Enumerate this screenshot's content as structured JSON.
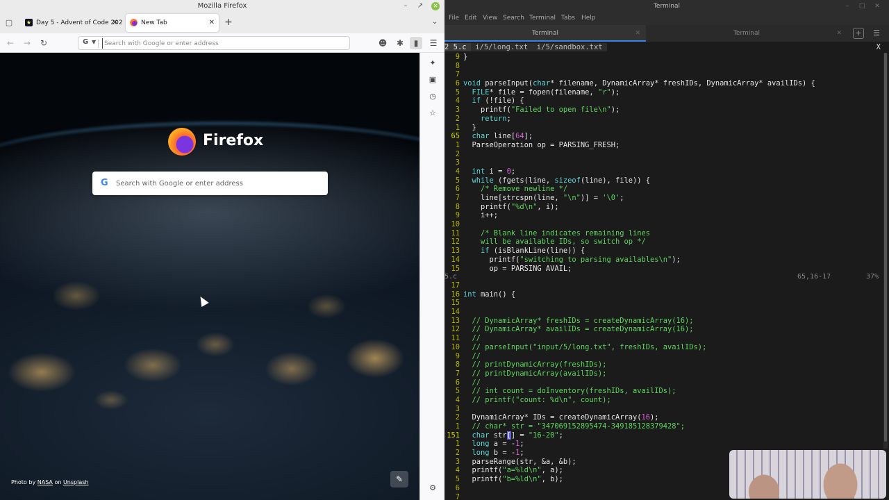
{
  "firefox": {
    "window_title": "Mozilla Firefox",
    "tabs": [
      {
        "label": "Day 5 - Advent of Code 2025",
        "active": false
      },
      {
        "label": "New Tab",
        "active": true
      }
    ],
    "url_placeholder": "Search with Google or enter address",
    "search_placeholder": "Search with Google or enter address",
    "logo_text": "Firefox",
    "credit": {
      "prefix": "Photo by",
      "author": "NASA",
      "on": "on",
      "site": "Unsplash"
    },
    "sidebar_icons": [
      "ai-chatbot-icon",
      "synced-tabs-icon",
      "history-icon",
      "bookmarks-icon",
      "settings-icon"
    ]
  },
  "terminal": {
    "window_title": "Terminal",
    "menu": [
      "File",
      "Edit",
      "View",
      "Search",
      "Terminal",
      "Tabs",
      "Help"
    ],
    "tabs": [
      {
        "label": "Terminal",
        "active": true
      },
      {
        "label": "Terminal",
        "active": false
      }
    ],
    "vim_tabs": [
      {
        "num": "2",
        "label": "5.c",
        "selected": true
      },
      {
        "label": "i/5/long.txt",
        "selected": false
      },
      {
        "label": "i/5/sandbox.txt",
        "selected": false
      }
    ],
    "vim_close": "X",
    "top_pane": [
      {
        "ln": "9",
        "code": "}"
      },
      {
        "ln": "8",
        "code": ""
      },
      {
        "ln": "7",
        "code": ""
      },
      {
        "ln": "6",
        "code": "void parseInput(char* filename, DynamicArray* freshIDs, DynamicArray* availIDs) {"
      },
      {
        "ln": "5",
        "code": "  FILE* file = fopen(filename, \"r\");"
      },
      {
        "ln": "4",
        "code": "  if (!file) {"
      },
      {
        "ln": "3",
        "code": "    printf(\"Failed to open file\\n\");"
      },
      {
        "ln": "2",
        "code": "    return;"
      },
      {
        "ln": "1",
        "code": "  }"
      },
      {
        "ln": "65",
        "code": "  char line[64];",
        "current": true
      },
      {
        "ln": "1",
        "code": "  ParseOperation op = PARSING_FRESH;"
      },
      {
        "ln": "2",
        "code": ""
      },
      {
        "ln": "3",
        "code": ""
      },
      {
        "ln": "4",
        "code": "  int i = 0;"
      },
      {
        "ln": "5",
        "code": "  while (fgets(line, sizeof(line), file)) {"
      },
      {
        "ln": "6",
        "code": "    /* Remove newline */"
      },
      {
        "ln": "7",
        "code": "    line[strcspn(line, \"\\n\")] = '\\0';"
      },
      {
        "ln": "8",
        "code": "    printf(\"%d\\n\", i);"
      },
      {
        "ln": "9",
        "code": "    i++;"
      },
      {
        "ln": "10",
        "code": ""
      },
      {
        "ln": "11",
        "code": "    /* Blank line indicates remaining lines"
      },
      {
        "ln": "12",
        "code": "    will be available IDs, so switch op */"
      },
      {
        "ln": "13",
        "code": "    if (isBlankLine(line)) {"
      },
      {
        "ln": "14",
        "code": "      printf(\"switching to parsing availables\\n\");"
      },
      {
        "ln": "15",
        "code": "      op = PARSING_AVAIL;"
      }
    ],
    "status_top": {
      "file": "5.c",
      "pos": "65,16-17",
      "pct": "37%"
    },
    "bottom_pane": [
      {
        "ln": "17",
        "code": ""
      },
      {
        "ln": "16",
        "code": "int main() {"
      },
      {
        "ln": "15",
        "code": ""
      },
      {
        "ln": "14",
        "code": ""
      },
      {
        "ln": "13",
        "code": "  // DynamicArray* freshIDs = createDynamicArray(16);"
      },
      {
        "ln": "12",
        "code": "  // DynamicArray* availIDs = createDynamicArray(16);"
      },
      {
        "ln": "11",
        "code": "  //"
      },
      {
        "ln": "10",
        "code": "  // parseInput(\"input/5/long.txt\", freshIDs, availIDs);"
      },
      {
        "ln": "9",
        "code": "  //"
      },
      {
        "ln": "8",
        "code": "  // printDynamicArray(freshIDs);"
      },
      {
        "ln": "7",
        "code": "  // printDynamicArray(availIDs);"
      },
      {
        "ln": "6",
        "code": "  //"
      },
      {
        "ln": "5",
        "code": "  // int count = doInventory(freshIDs, availIDs);"
      },
      {
        "ln": "4",
        "code": "  // printf(\"count: %d\\n\", count);"
      },
      {
        "ln": "3",
        "code": ""
      },
      {
        "ln": "2",
        "code": "  DynamicArray* IDs = createDynamicArray(16);"
      },
      {
        "ln": "1",
        "code": "  // char* str = \"347069152895474-349185128379428\";"
      },
      {
        "ln": "151",
        "code": "  char str[] = \"16-20\";",
        "current": true
      },
      {
        "ln": "1",
        "code": "  long a = -1;"
      },
      {
        "ln": "2",
        "code": "  long b = -1;"
      },
      {
        "ln": "3",
        "code": "  parseRange(str, &a, &b);"
      },
      {
        "ln": "4",
        "code": "  printf(\"a=%ld\\n\", a);"
      },
      {
        "ln": "5",
        "code": "  printf(\"b=%ld\\n\", b);"
      },
      {
        "ln": "6",
        "code": ""
      },
      {
        "ln": "7",
        "code": ""
      }
    ]
  },
  "colors": {
    "line_numbers": "#b5b500",
    "keyword": "#5fd7d7",
    "string": "#5fd75f",
    "comment": "#5fd75f",
    "number": "#d75fd7",
    "terminal_bg": "#1b1b1b",
    "tab_accent": "#3584e4"
  }
}
